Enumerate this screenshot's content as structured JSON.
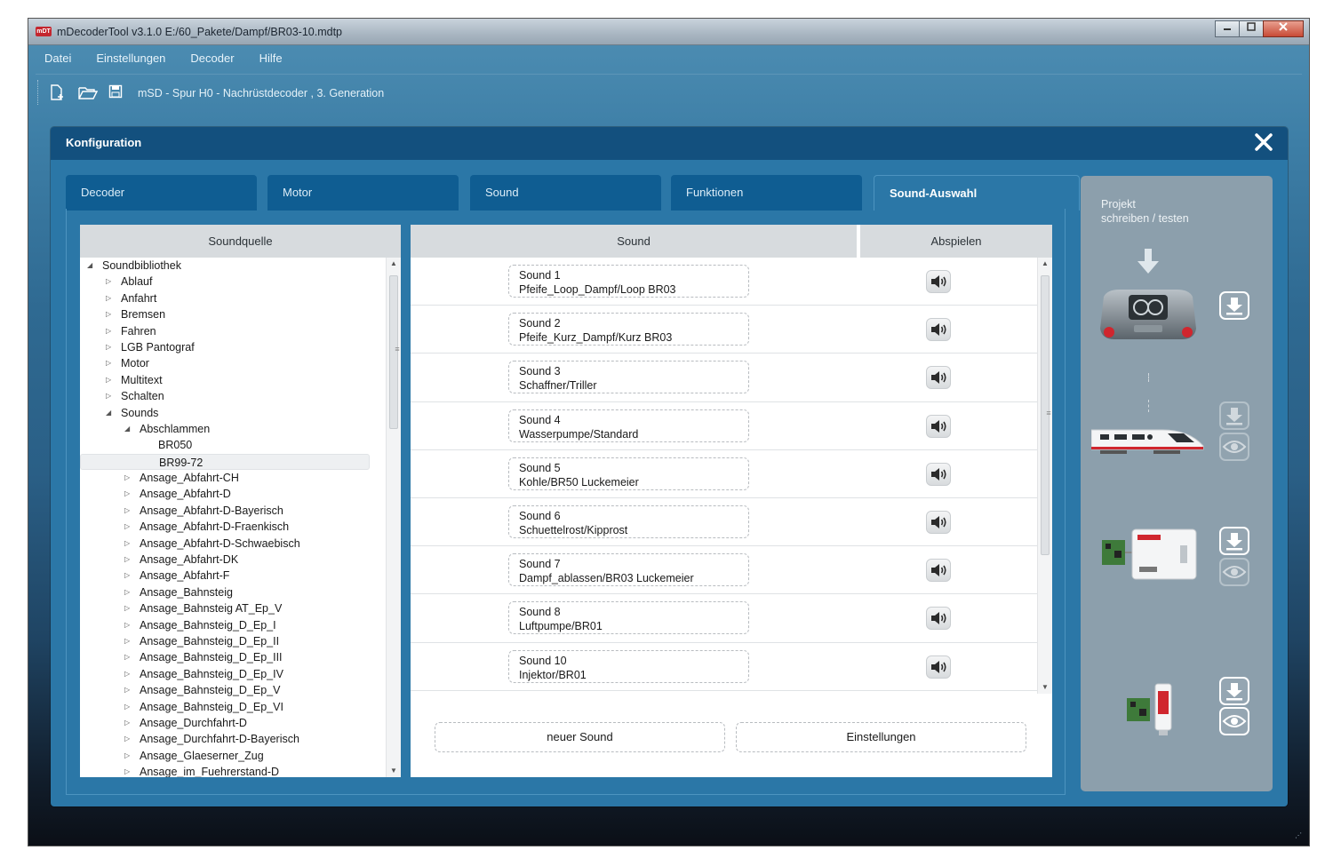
{
  "window": {
    "title": "mDecoderTool v3.1.0  E:/60_Pakete/Dampf/BR03-10.mdtp",
    "icon_text": "mDT",
    "controls": [
      "minimize-icon",
      "maximize-icon",
      "close-icon"
    ]
  },
  "menu": [
    "Datei",
    "Einstellungen",
    "Decoder",
    "Hilfe"
  ],
  "toolbar": {
    "icons": [
      "new-file-icon",
      "open-folder-icon",
      "save-icon"
    ],
    "project_label": "mSD - Spur H0 - Nachrüstdecoder , 3. Generation"
  },
  "config": {
    "title": "Konfiguration",
    "close_icon": "close-x-icon",
    "tabs": [
      {
        "label": "Decoder",
        "active": false
      },
      {
        "label": "Motor",
        "active": false
      },
      {
        "label": "Sound",
        "active": false
      },
      {
        "label": "Funktionen",
        "active": false
      },
      {
        "label": "Sound-Auswahl",
        "active": true
      }
    ]
  },
  "soundquelle": {
    "header": "Soundquelle",
    "tree": [
      {
        "label": "Soundbibliothek",
        "level": 0,
        "expanded": true
      },
      {
        "label": "Ablauf",
        "level": 1,
        "expanded": false
      },
      {
        "label": "Anfahrt",
        "level": 1,
        "expanded": false
      },
      {
        "label": "Bremsen",
        "level": 1,
        "expanded": false
      },
      {
        "label": "Fahren",
        "level": 1,
        "expanded": false
      },
      {
        "label": "LGB Pantograf",
        "level": 1,
        "expanded": false
      },
      {
        "label": "Motor",
        "level": 1,
        "expanded": false
      },
      {
        "label": "Multitext",
        "level": 1,
        "expanded": false
      },
      {
        "label": "Schalten",
        "level": 1,
        "expanded": false
      },
      {
        "label": "Sounds",
        "level": 1,
        "expanded": true
      },
      {
        "label": "Abschlammen",
        "level": 2,
        "expanded": true
      },
      {
        "label": "BR050",
        "level": 3,
        "leaf": true
      },
      {
        "label": "BR99-72",
        "level": 3,
        "leaf": true,
        "selected": true
      },
      {
        "label": "Ansage_Abfahrt-CH",
        "level": 2,
        "expanded": false
      },
      {
        "label": "Ansage_Abfahrt-D",
        "level": 2,
        "expanded": false
      },
      {
        "label": "Ansage_Abfahrt-D-Bayerisch",
        "level": 2,
        "expanded": false
      },
      {
        "label": "Ansage_Abfahrt-D-Fraenkisch",
        "level": 2,
        "expanded": false
      },
      {
        "label": "Ansage_Abfahrt-D-Schwaebisch",
        "level": 2,
        "expanded": false
      },
      {
        "label": "Ansage_Abfahrt-DK",
        "level": 2,
        "expanded": false
      },
      {
        "label": "Ansage_Abfahrt-F",
        "level": 2,
        "expanded": false
      },
      {
        "label": "Ansage_Bahnsteig",
        "level": 2,
        "expanded": false
      },
      {
        "label": "Ansage_Bahnsteig AT_Ep_V",
        "level": 2,
        "expanded": false
      },
      {
        "label": "Ansage_Bahnsteig_D_Ep_I",
        "level": 2,
        "expanded": false
      },
      {
        "label": "Ansage_Bahnsteig_D_Ep_II",
        "level": 2,
        "expanded": false
      },
      {
        "label": "Ansage_Bahnsteig_D_Ep_III",
        "level": 2,
        "expanded": false
      },
      {
        "label": "Ansage_Bahnsteig_D_Ep_IV",
        "level": 2,
        "expanded": false
      },
      {
        "label": "Ansage_Bahnsteig_D_Ep_V",
        "level": 2,
        "expanded": false
      },
      {
        "label": "Ansage_Bahnsteig_D_Ep_VI",
        "level": 2,
        "expanded": false
      },
      {
        "label": "Ansage_Durchfahrt-D",
        "level": 2,
        "expanded": false
      },
      {
        "label": "Ansage_Durchfahrt-D-Bayerisch",
        "level": 2,
        "expanded": false
      },
      {
        "label": "Ansage_Glaeserner_Zug",
        "level": 2,
        "expanded": false
      },
      {
        "label": "Ansage_im_Fuehrerstand-D",
        "level": 2,
        "expanded": false
      }
    ]
  },
  "sounds": {
    "header_sound": "Sound",
    "header_play": "Abspielen",
    "play_icon": "speaker-icon",
    "items": [
      {
        "slot": "Sound 1",
        "name": "Pfeife_Loop_Dampf/Loop BR03"
      },
      {
        "slot": "Sound 2",
        "name": "Pfeife_Kurz_Dampf/Kurz BR03"
      },
      {
        "slot": "Sound 3",
        "name": "Schaffner/Triller"
      },
      {
        "slot": "Sound 4",
        "name": "Wasserpumpe/Standard"
      },
      {
        "slot": "Sound 5",
        "name": "Kohle/BR50 Luckemeier"
      },
      {
        "slot": "Sound 6",
        "name": "Schuettelrost/Kipprost"
      },
      {
        "slot": "Sound 7",
        "name": "Dampf_ablassen/BR03 Luckemeier"
      },
      {
        "slot": "Sound 8",
        "name": "Luftpumpe/BR01"
      },
      {
        "slot": "Sound 10",
        "name": "Injektor/BR01"
      }
    ],
    "new_button": "neuer Sound",
    "settings_button": "Einstellungen"
  },
  "project_panel": {
    "title_line1": "Projekt",
    "title_line2": "schreiben / testen",
    "devices": [
      {
        "name": "mobile-station-device",
        "actions": [
          "download-icon"
        ]
      },
      {
        "name": "ice-train-device",
        "actions": [
          "download-icon",
          "eye-icon"
        ]
      },
      {
        "name": "decoder-programmer-device",
        "actions": [
          "download-icon",
          "eye-icon"
        ]
      },
      {
        "name": "usb-stick-device",
        "actions": [
          "download-icon",
          "eye-icon"
        ]
      }
    ]
  }
}
